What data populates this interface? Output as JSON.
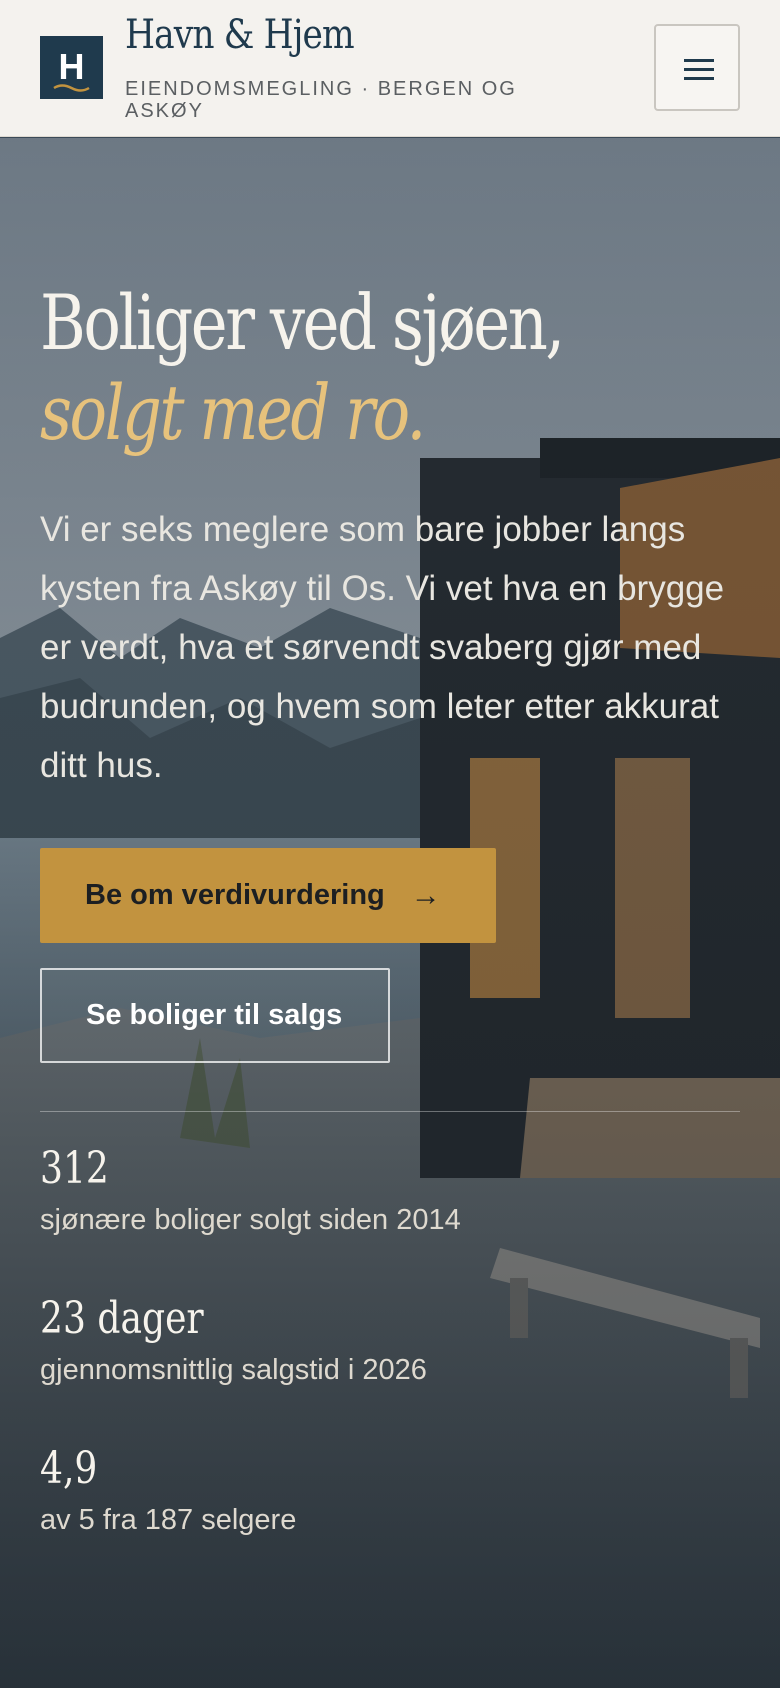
{
  "header": {
    "brand_name": "Havn & Hjem",
    "brand_tagline": "EIENDOMSMEGLING · BERGEN OG ASKØY",
    "logo_letter": "H",
    "menu_icon": "menu-icon"
  },
  "hero": {
    "headline": "Boliger ved sjøen,",
    "headline_accent": "solgt med ro.",
    "intro": "Vi er seks meglere som bare jobber langs kysten fra Askøy til Os. Vi vet hva en brygge er verdt, hva et sørvendt svaberg gjør med budrunden, og hvem som leter etter akkurat ditt hus.",
    "primary_cta": "Be om verdivurdering",
    "primary_cta_icon": "arrow-right-icon",
    "secondary_cta": "Se boliger til salgs"
  },
  "stats": [
    {
      "value": "312",
      "label": "sjønære boliger solgt siden 2014"
    },
    {
      "value": "23 dager",
      "label": "gjennomsnittlig salgstid i 2026"
    },
    {
      "value": "4,9",
      "label": "av 5 fra 187 selgere"
    }
  ],
  "colors": {
    "brand_navy": "#1f3a4d",
    "accent_gold": "#c2933f",
    "headline_gold": "#e7c27c",
    "header_bg": "#f4f2ee"
  }
}
